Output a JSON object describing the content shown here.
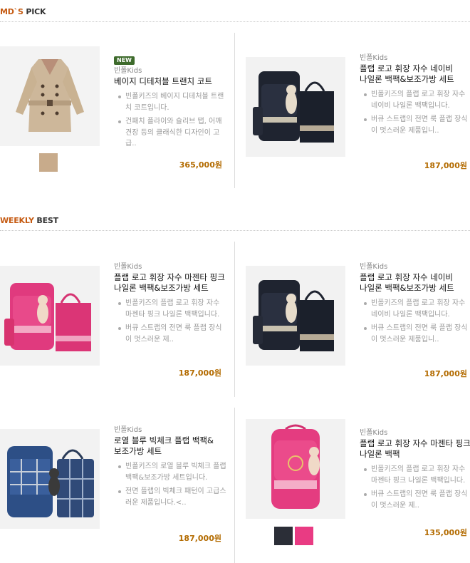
{
  "sections": {
    "md_pick": {
      "accent": "MD`S",
      "rest": " PICK"
    },
    "weekly_best": {
      "accent": "WEEKLY",
      "rest": " BEST"
    }
  },
  "products": [
    {
      "badge": "NEW",
      "brand": "빈폴Kids",
      "name": "베이지 디테처블 트랜치 코트",
      "desc": [
        "빈폴키즈의 베이지 디테처블 트랜치 코트입니다.",
        "건패치 플라이와 슐리브 탭, 어깨 견장 등의 클래식한 디자인이 고급.."
      ],
      "price": "365,000원",
      "image": "trench-coat",
      "swatches": [
        "#c8ab8b"
      ]
    },
    {
      "brand": "빈폴Kids",
      "name": "플랩 로고 휘장 자수 네이비 나일론 백팩&보조가방 세트",
      "desc": [
        "빈폴키즈의 플랩 로고 휘장 자수 네이비 나일론 백팩입니다.",
        "버큐 스트랩의 전면 룩 플랩 장식이 멋스러운 제품입니.."
      ],
      "price": "187,000원",
      "image": "navy-backpack-set"
    },
    {
      "brand": "빈폴Kids",
      "name": "플랩 로고 휘장 자수 마젠타 핑크 나일론 백팩&보조가방 세트",
      "desc": [
        "빈폴키즈의 플랩 로고 휘장 자수 마젠타 핑크 나일론 백팩입니다.",
        "버큐 스트랩의 전면 룩 플랩 장식이 멋스러운 제.."
      ],
      "price": "187,000원",
      "image": "pink-backpack-set"
    },
    {
      "brand": "빈폴Kids",
      "name": "플랩 로고 휘장 자수 네이비 나일론 백팩&보조가방 세트",
      "desc": [
        "빈폴키즈의 플랩 로고 휘장 자수 네이비 나일론 백팩입니다.",
        "버큐 스트랩의 전면 룩 플랩 장식이 멋스러운 제품입니.."
      ],
      "price": "187,000원",
      "image": "navy-backpack-set"
    },
    {
      "brand": "빈폴Kids",
      "name": "로열 블루 빅체크 플랩 백팩&보조가방 세트",
      "desc": [
        "빈폴키즈의 로열 블루 빅체크 플랩 백팩&보조가방 세트입니다.",
        "전면 플랩의 빅체크 패턴이 고급스러운 제품입니다.<.."
      ],
      "price": "187,000원",
      "image": "blue-check-backpack-set"
    },
    {
      "brand": "빈폴Kids",
      "name": "플랩 로고 휘장 자수 마젠타 핑크 나일론 백팩",
      "desc": [
        "빈폴키즈의 플랩 로고 휘장 자수 마젠타 핑크 나일론 백팩입니다.",
        "버큐 스트랩의 전면 룩 플랩 장식이 멋스러운 제.."
      ],
      "price": "135,000원",
      "image": "pink-backpack",
      "swatches": [
        "#2b2e37",
        "#e93b83"
      ]
    }
  ]
}
